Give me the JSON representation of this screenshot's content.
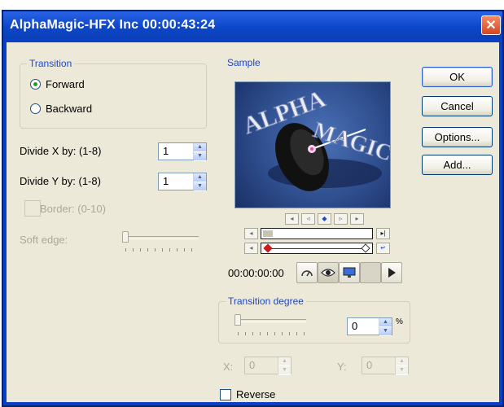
{
  "window": {
    "title": "AlphaMagic-HFX Inc  00:00:43:24",
    "close_glyph": "✕"
  },
  "transition": {
    "title": "Transition",
    "forward_label": "Forward",
    "backward_label": "Backward",
    "selected": "Forward"
  },
  "divide_x": {
    "label": "Divide X by: (1-8)",
    "value": "1"
  },
  "divide_y": {
    "label": "Divide Y by: (1-8)",
    "value": "1"
  },
  "border": {
    "label": "Border: (0-10)",
    "enabled": false
  },
  "soft_edge": {
    "label": "Soft edge:",
    "level": 0
  },
  "sample": {
    "title": "Sample",
    "preview_text_line1": "ALPHA",
    "preview_text_line2": "MAGIC",
    "timecode": "00:00:00:00"
  },
  "transition_degree": {
    "title": "Transition degree",
    "value": "0",
    "unit": "%",
    "level": 0
  },
  "coords": {
    "x_label": "X:",
    "x_value": "0",
    "y_label": "Y:",
    "y_value": "0"
  },
  "reverse": {
    "label": "Reverse",
    "checked": false
  },
  "buttons": {
    "ok": "OK",
    "cancel": "Cancel",
    "options": "Options...",
    "add": "Add..."
  },
  "colors": {
    "titlebar": "#0c46c8",
    "group_title": "#1f47c8",
    "dialog_bg": "#ece9d8",
    "close": "#d8451f"
  },
  "icons": [
    "close-icon",
    "speedometer-icon",
    "eye-icon",
    "monitor-icon",
    "play-icon"
  ]
}
